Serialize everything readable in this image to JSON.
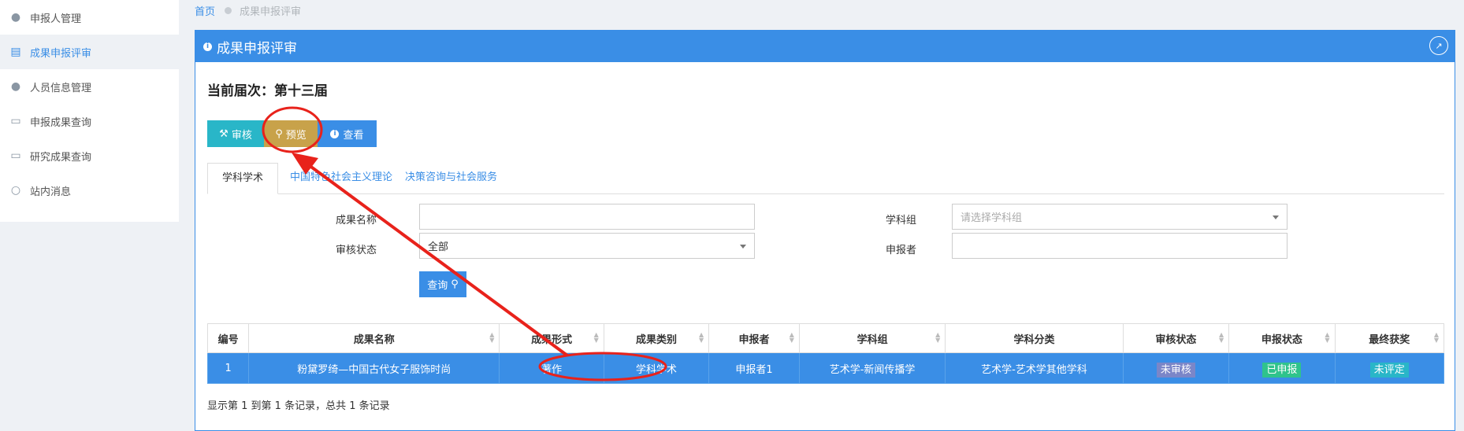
{
  "sidebar": {
    "items": [
      {
        "label": "申报人管理",
        "icon": "user-icon"
      },
      {
        "label": "成果申报评审",
        "icon": "document-icon",
        "active": true
      },
      {
        "label": "人员信息管理",
        "icon": "user-icon"
      },
      {
        "label": "申报成果查询",
        "icon": "code-file-icon"
      },
      {
        "label": "研究成果查询",
        "icon": "file-icon"
      },
      {
        "label": "站内消息",
        "icon": "chat-icon"
      }
    ]
  },
  "breadcrumb": {
    "home": "首页",
    "current": "成果申报评审"
  },
  "panel": {
    "title": "成果申报评审"
  },
  "term": "当前届次：第十三届",
  "toolbar": {
    "audit": "审核",
    "preview": "预览",
    "view": "查看"
  },
  "tabs": [
    "学科学术",
    "中国特色社会主义理论",
    "决策咨询与社会服务"
  ],
  "filters": {
    "name_label": "成果名称",
    "name_value": "",
    "group_label": "学科组",
    "group_placeholder": "请选择学科组",
    "status_label": "审核状态",
    "status_value": "全部",
    "applicant_label": "申报者",
    "applicant_value": "",
    "search_button": "查询"
  },
  "table": {
    "headers": [
      "编号",
      "成果名称",
      "成果形式",
      "成果类别",
      "申报者",
      "学科组",
      "学科分类",
      "审核状态",
      "申报状态",
      "最终获奖"
    ],
    "rows": [
      [
        "1",
        "粉黛罗绮—中国古代女子服饰时尚",
        "著作",
        "学科学术",
        "申报者1",
        "艺术学-新闻传播学",
        "艺术学-艺术学其他学科",
        "未审核",
        "已申报",
        "未评定"
      ]
    ]
  },
  "footer": "显示第 1 到第 1 条记录，总共 1 条记录",
  "colors": {
    "primary": "#3a8ee6",
    "audit": "#29b6c8",
    "preview": "#c8a24a",
    "annotation": "#e8221b"
  }
}
